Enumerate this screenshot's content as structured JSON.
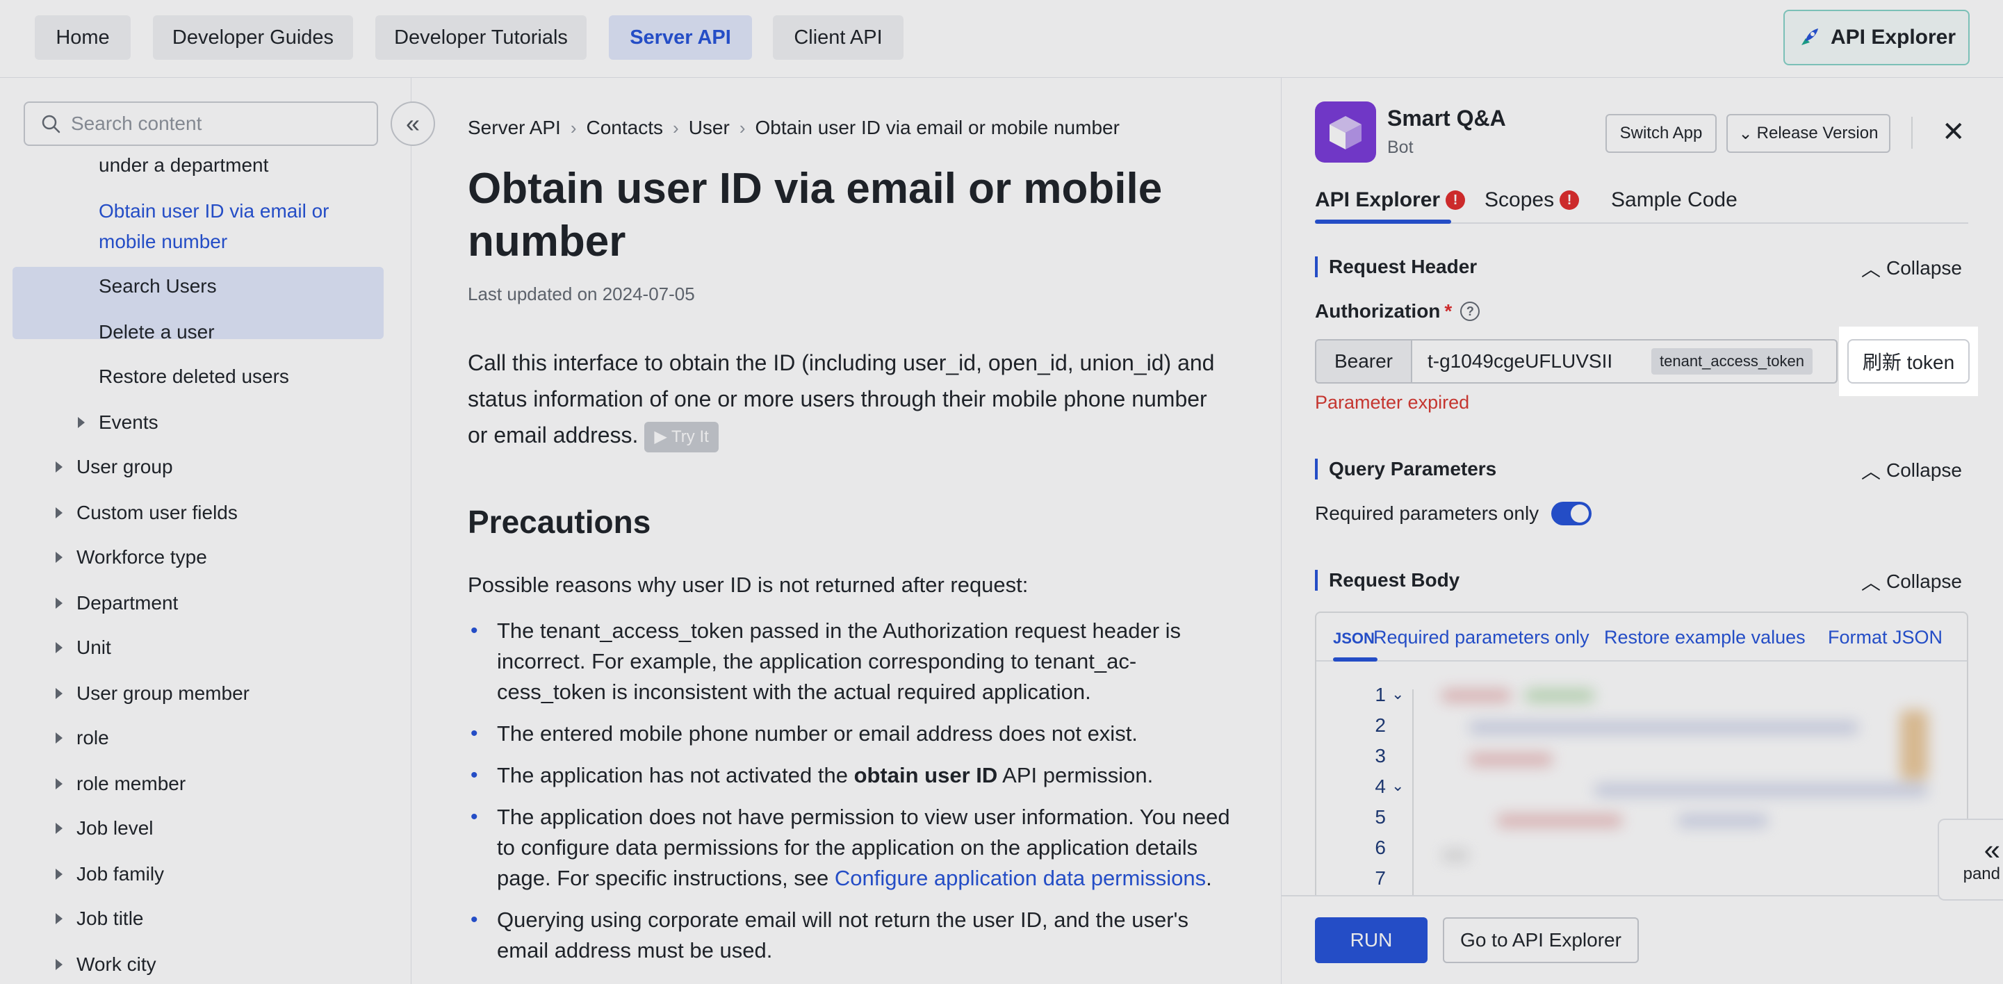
{
  "topnav": {
    "tabs": [
      {
        "label": "Home",
        "active": false
      },
      {
        "label": "Developer Guides",
        "active": false
      },
      {
        "label": "Developer Tutorials",
        "active": false
      },
      {
        "label": "Server API",
        "active": true
      },
      {
        "label": "Client API",
        "active": false
      }
    ],
    "api_explorer_label": "API Explorer"
  },
  "sidebar": {
    "search_placeholder": "Search content",
    "items": [
      {
        "label": "under a department",
        "level": 2,
        "expandable": false
      },
      {
        "label": "Obtain user ID via email or mobile number",
        "level": 2,
        "expandable": false,
        "active": true
      },
      {
        "label": "Search Users",
        "level": 2,
        "expandable": false
      },
      {
        "label": "Delete a user",
        "level": 2,
        "expandable": false
      },
      {
        "label": "Restore deleted users",
        "level": 2,
        "expandable": false
      },
      {
        "label": "Events",
        "level": 2,
        "expandable": true
      },
      {
        "label": "User group",
        "level": 1,
        "expandable": true
      },
      {
        "label": "Custom user fields",
        "level": 1,
        "expandable": true
      },
      {
        "label": "Workforce type",
        "level": 1,
        "expandable": true
      },
      {
        "label": "Department",
        "level": 1,
        "expandable": true
      },
      {
        "label": "Unit",
        "level": 1,
        "expandable": true
      },
      {
        "label": "User group member",
        "level": 1,
        "expandable": true
      },
      {
        "label": "role",
        "level": 1,
        "expandable": true
      },
      {
        "label": "role member",
        "level": 1,
        "expandable": true
      },
      {
        "label": "Job level",
        "level": 1,
        "expandable": true
      },
      {
        "label": "Job family",
        "level": 1,
        "expandable": true
      },
      {
        "label": "Job title",
        "level": 1,
        "expandable": true
      },
      {
        "label": "Work city",
        "level": 1,
        "expandable": true
      }
    ],
    "active_line1": "Obtain user ID via email or",
    "active_line2": "mobile number"
  },
  "main": {
    "breadcrumb": [
      "Server API",
      "Contacts",
      "User",
      "Obtain user ID via email or mobile number"
    ],
    "title": "Obtain user ID via email or mobile number",
    "updated": "Last updated on 2024-07-05",
    "intro": "Call this interface to obtain the ID (including user_id, open_id, union_id) and status information of one or more users through their mobile phone number or email address.",
    "try_it": "Try It",
    "precautions_heading": "Precautions",
    "reasons_lead": "Possible reasons why user ID is not returned after request:",
    "bullet1": "The tenant_access_token passed in the Authorization request header is incorrect. For example, the application corresponding to tenant_ac-cess_token is inconsistent with the actual required application.",
    "bullet2": "The entered mobile phone number or email address does not exist.",
    "bullet3_pre": "The application has not activated the ",
    "bullet3_bold": "obtain user ID",
    "bullet3_post": " API permission.",
    "bullet4_pre": "The application does not have permission to view user information. You need to configure data permissions for the application on the application details page. For specific instructions, see ",
    "bullet4_link": "Configure application data permissions",
    "bullet4_post": ".",
    "bullet5": "Querying using corporate email will not return the user ID, and the user's email address must be used."
  },
  "panel": {
    "app_name": "Smart Q&A",
    "app_type": "Bot",
    "switch_app": "Switch App",
    "release_version": "Release Version",
    "tabs": [
      {
        "label": "API Explorer",
        "warning": true,
        "active": true
      },
      {
        "label": "Scopes",
        "warning": true,
        "active": false
      },
      {
        "label": "Sample Code",
        "warning": false,
        "active": false
      }
    ],
    "warn_glyph": "!",
    "collapse_label": "Collapse",
    "request_header": "Request Header",
    "authorization_label": "Authorization",
    "required_mark": "*",
    "help_glyph": "?",
    "bearer": "Bearer",
    "token_value": "t-g1049cgeUFLUVSII",
    "token_type": "tenant_access_token",
    "refresh_token": "刷新 token",
    "param_expired": "Parameter expired",
    "query_parameters": "Query Parameters",
    "required_only": "Required parameters only",
    "required_only_on": true,
    "request_body": "Request Body",
    "body_tabs": [
      "JSON",
      "Required parameters only",
      "Restore example values",
      "Format JSON"
    ],
    "line_numbers": [
      "1",
      "2",
      "3",
      "4",
      "5",
      "6",
      "7"
    ],
    "run": "RUN",
    "goto_explorer": "Go to API Explorer",
    "expand_label": "pand"
  }
}
